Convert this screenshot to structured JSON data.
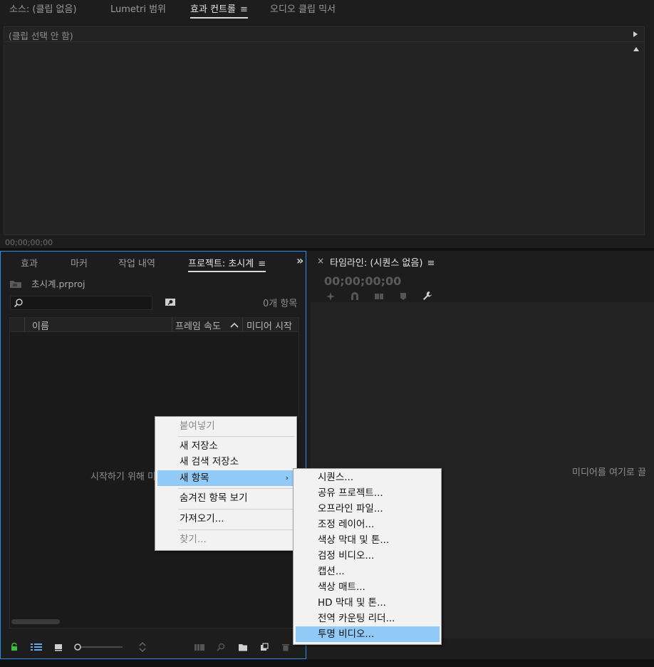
{
  "top_tabs": [
    {
      "label": "소스: (클립 없음)",
      "active": false
    },
    {
      "label": "Lumetri 범위",
      "active": false
    },
    {
      "label": "효과 컨트롤",
      "active": true
    },
    {
      "label": "오디오 클립 믹서",
      "active": false
    }
  ],
  "effect_controls": {
    "header_text": "(클립 선택 안 함)",
    "timecode": "00;00;00;00"
  },
  "project_panel": {
    "tabs": [
      {
        "label": "효과",
        "active": false
      },
      {
        "label": "마커",
        "active": false
      },
      {
        "label": "작업 내역",
        "active": false
      },
      {
        "label": "프로젝트: 초시계",
        "active": true
      }
    ],
    "overflow_glyph": "»",
    "project_file": "초시계.prproj",
    "search_placeholder": "",
    "item_count": "0개 항목",
    "columns": [
      "이름",
      "프레임 속도",
      "미디어 시작"
    ],
    "empty_message": "시작하기 위해 미"
  },
  "timeline_panel": {
    "close_glyph": "×",
    "title": "타임라인: (시퀀스 없음)",
    "timecode": "00;00;00;00",
    "drop_message": "미디어를 여기로 끌"
  },
  "menu_glyph": "≡",
  "context_menu": {
    "items": [
      {
        "label": "붙여넣기",
        "disabled": true
      },
      {
        "label": "새 저장소",
        "disabled": false
      },
      {
        "label": "새 검색 저장소",
        "disabled": false
      },
      {
        "label": "새 항목",
        "disabled": false,
        "highlighted": true,
        "has_submenu": true
      },
      {
        "label": "숨겨진 항목 보기",
        "disabled": false
      },
      {
        "label": "가져오기...",
        "disabled": false
      },
      {
        "label": "찾기...",
        "disabled": true
      }
    ],
    "submenu_arrow": "›"
  },
  "submenu": {
    "items": [
      {
        "label": "시퀀스..."
      },
      {
        "label": "공유 프로젝트..."
      },
      {
        "label": "오프라인 파일..."
      },
      {
        "label": "조정 레이어..."
      },
      {
        "label": "색상 막대 및 톤..."
      },
      {
        "label": "검정 비디오..."
      },
      {
        "label": "캡션..."
      },
      {
        "label": "색상 매트..."
      },
      {
        "label": "HD 막대 및 톤..."
      },
      {
        "label": "전역 카운팅 리더..."
      },
      {
        "label": "투명 비디오...",
        "highlighted": true
      }
    ]
  },
  "colors": {
    "accent_blue": "#2d8ceb",
    "menu_highlight": "#91c9f7",
    "lock_green": "#3fbf3f"
  }
}
